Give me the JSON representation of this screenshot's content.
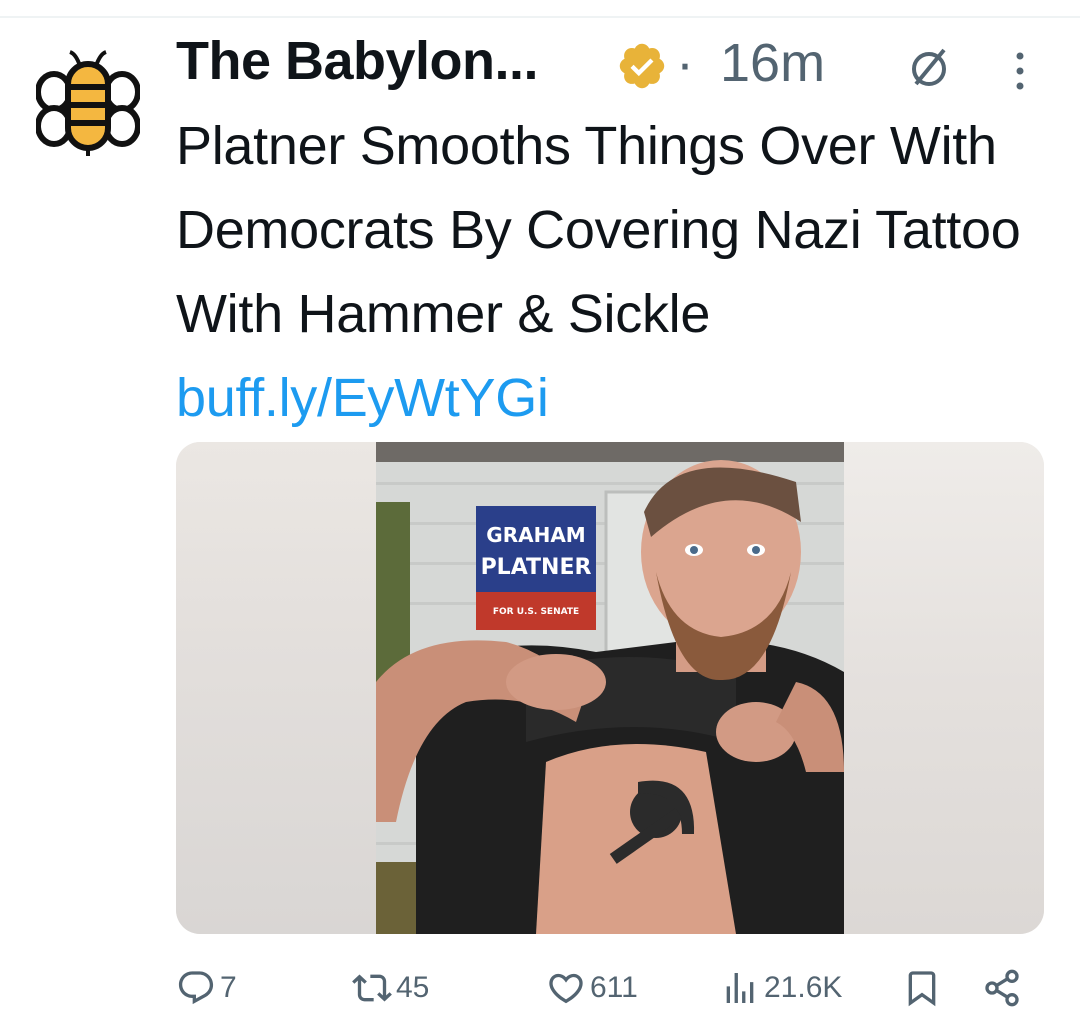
{
  "author": {
    "display_name": "The Babylon...",
    "time_ago": "16m",
    "separator": "·"
  },
  "tweet": {
    "text": "Platner Smooths Things Over With Democrats By Covering Nazi Tattoo With Hammer & Sickle ",
    "link_text": "buff.ly/EyWtYGi"
  },
  "media": {
    "sign_line1": "GRAHAM",
    "sign_line2": "PLATNER",
    "sign_line3": "FOR U.S. SENATE"
  },
  "actions": {
    "replies": "7",
    "reposts": "45",
    "likes": "611",
    "views": "21.6K"
  },
  "colors": {
    "text": "#0f1419",
    "secondary": "#536471",
    "link": "#1d9bf0",
    "verified_gold": "#e8b339",
    "bee_yellow": "#f4b740"
  },
  "icons": [
    "bee-logo-icon",
    "verified-badge-icon",
    "grok-icon",
    "more-icon",
    "reply-icon",
    "repost-icon",
    "like-icon",
    "views-icon",
    "bookmark-icon",
    "share-icon"
  ]
}
